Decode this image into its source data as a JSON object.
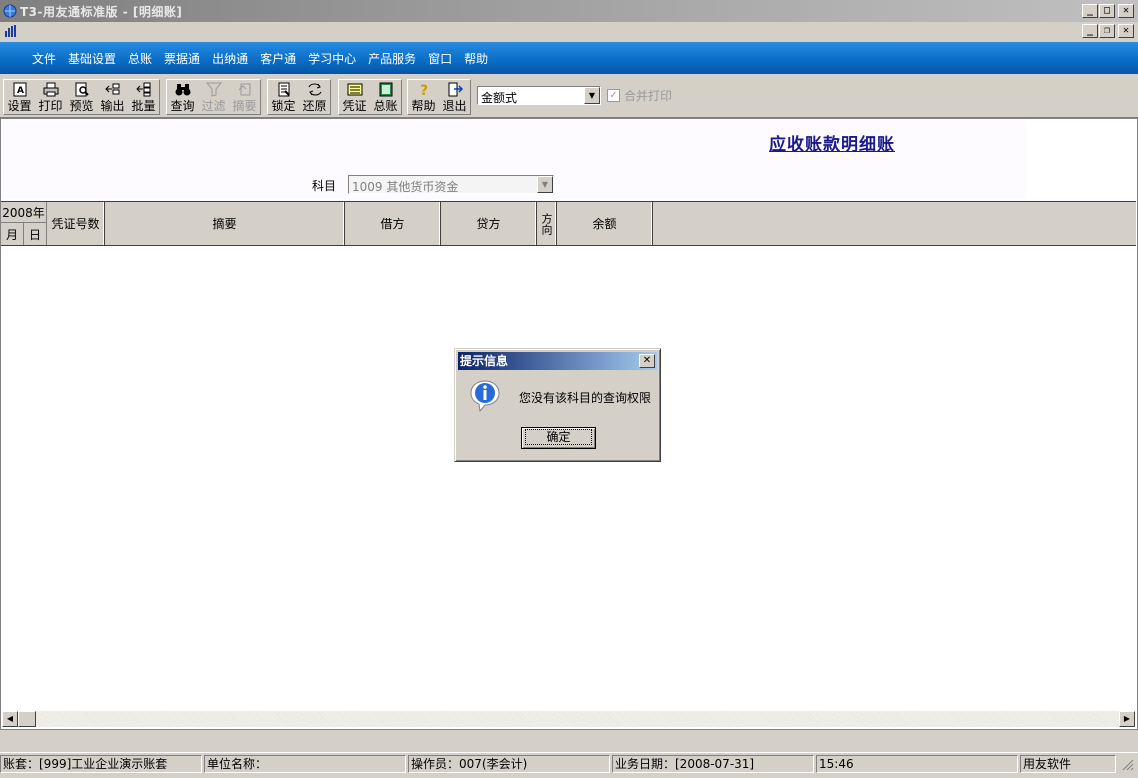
{
  "window": {
    "title": "T3-用友通标准版 - [明细账]"
  },
  "menu": [
    "文件",
    "基础设置",
    "总账",
    "票据通",
    "出纳通",
    "客户通",
    "学习中心",
    "产品服务",
    "窗口",
    "帮助"
  ],
  "toolbar": {
    "buttons": [
      {
        "label": "设置",
        "icon": "settings-icon",
        "enabled": true
      },
      {
        "label": "打印",
        "icon": "printer-icon",
        "enabled": true
      },
      {
        "label": "预览",
        "icon": "preview-icon",
        "enabled": true
      },
      {
        "label": "输出",
        "icon": "export-icon",
        "enabled": true
      },
      {
        "label": "批量",
        "icon": "batch-icon",
        "enabled": true
      },
      {
        "label": "查询",
        "icon": "binoculars-icon",
        "enabled": true
      },
      {
        "label": "过滤",
        "icon": "filter-icon",
        "enabled": false
      },
      {
        "label": "摘要",
        "icon": "summary-icon",
        "enabled": false
      },
      {
        "label": "锁定",
        "icon": "lock-icon",
        "enabled": true
      },
      {
        "label": "还原",
        "icon": "restore-icon",
        "enabled": true
      },
      {
        "label": "凭证",
        "icon": "voucher-icon",
        "enabled": true
      },
      {
        "label": "总账",
        "icon": "ledger-icon",
        "enabled": true
      },
      {
        "label": "帮助",
        "icon": "help-icon",
        "enabled": true
      },
      {
        "label": "退出",
        "icon": "exit-icon",
        "enabled": true
      }
    ],
    "format_select": "金额式",
    "merge_print_label": "合并打印",
    "merge_print_checked": true
  },
  "report": {
    "title": "应收账款明细账",
    "subject_label": "科目",
    "subject_value": "1009 其他货币资金"
  },
  "table": {
    "year": "2008年",
    "month": "月",
    "day": "日",
    "voucher_no": "凭证号数",
    "summary": "摘要",
    "debit": "借方",
    "credit": "贷方",
    "direction": "方向",
    "balance": "余额"
  },
  "dialog": {
    "title": "提示信息",
    "message": "您没有该科目的查询权限",
    "ok_label": "确定"
  },
  "status": {
    "account_set": "账套：[999]工业企业演示账套",
    "unit_name": "单位名称：",
    "operator": "操作员：007(李会计)",
    "business_date": "业务日期：[2008-07-31]",
    "time": "15:46",
    "vendor": "用友软件"
  }
}
